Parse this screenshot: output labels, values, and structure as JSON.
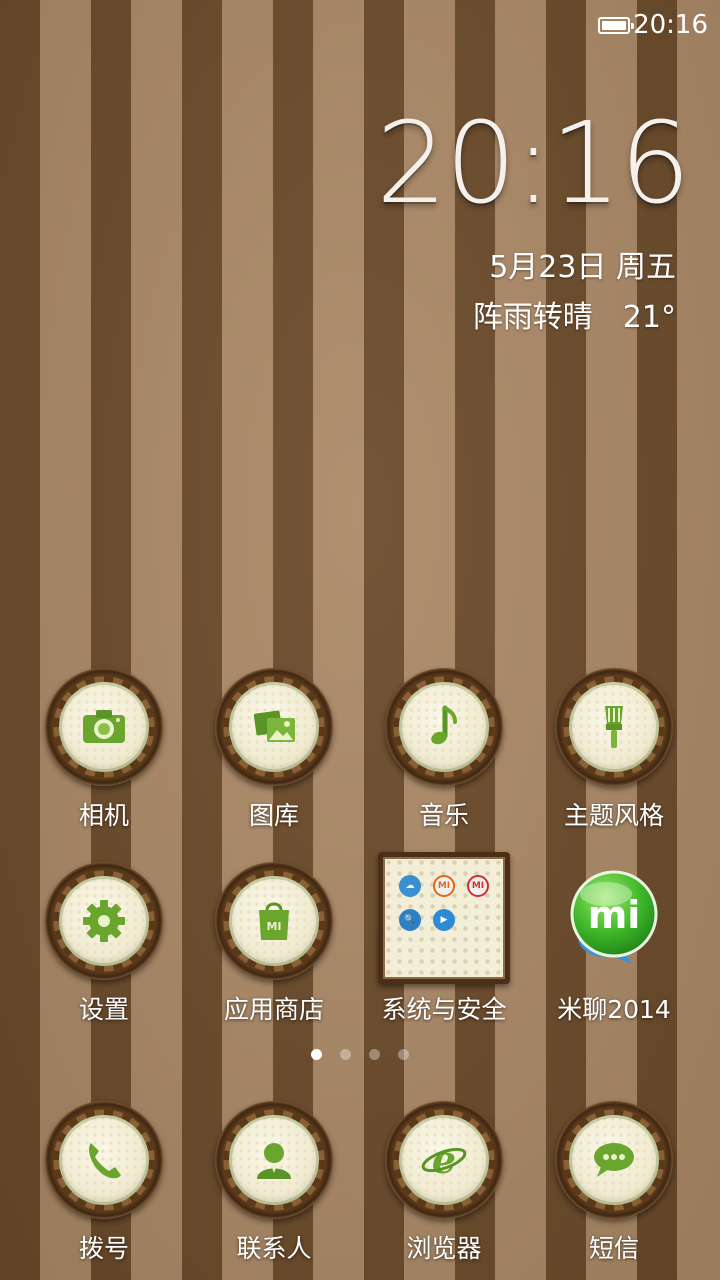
{
  "status_bar": {
    "time": "20:16",
    "battery_icon": "battery-full-icon"
  },
  "clock_widget": {
    "time": "20:16",
    "date": "5月23日 周五",
    "weather": "阵雨转晴　21°"
  },
  "apps": [
    {
      "label": "相机",
      "icon": "camera-icon"
    },
    {
      "label": "图库",
      "icon": "gallery-icon"
    },
    {
      "label": "音乐",
      "icon": "music-note-icon"
    },
    {
      "label": "主题风格",
      "icon": "paintbrush-icon"
    },
    {
      "label": "设置",
      "icon": "gear-icon"
    },
    {
      "label": "应用商店",
      "icon": "shopping-bag-icon"
    },
    {
      "label": "系统与安全",
      "icon": "folder-icon"
    },
    {
      "label": "米聊2014",
      "icon": "mi-chat-icon"
    }
  ],
  "folder_contents": [
    {
      "icon": "cloud-icon",
      "glyph": "☁"
    },
    {
      "icon": "mi-icon",
      "glyph": "MI"
    },
    {
      "icon": "mi-icon",
      "glyph": "MI"
    },
    {
      "icon": "search-icon",
      "glyph": "🔍"
    },
    {
      "icon": "play-icon",
      "glyph": "▶"
    }
  ],
  "page_indicator": {
    "count": 4,
    "active": 0
  },
  "dock": [
    {
      "label": "拨号",
      "icon": "phone-icon"
    },
    {
      "label": "联系人",
      "icon": "contact-icon"
    },
    {
      "label": "浏览器",
      "icon": "browser-icon"
    },
    {
      "label": "短信",
      "icon": "message-icon"
    }
  ],
  "colors": {
    "stripe_dark": "#6b4a2a",
    "stripe_light": "#ab8966",
    "icon_green": "#6aa52e",
    "frame_brown": "#5a3919"
  }
}
